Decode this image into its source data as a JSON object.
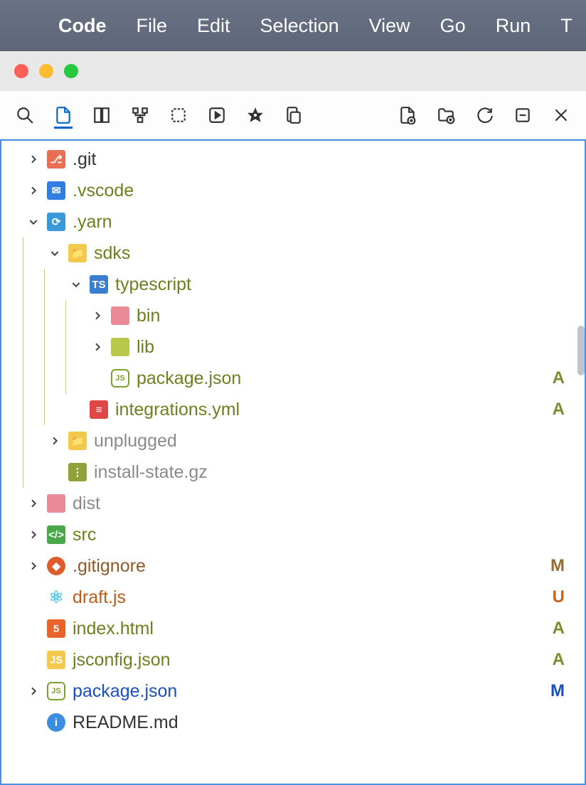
{
  "menubar": {
    "app": "Code",
    "items": [
      "File",
      "Edit",
      "Selection",
      "View",
      "Go",
      "Run",
      "T"
    ]
  },
  "tree": [
    {
      "depth": 0,
      "chev": "right",
      "icon": "git",
      "label": ".git",
      "color": "default",
      "status": ""
    },
    {
      "depth": 0,
      "chev": "right",
      "icon": "vscode",
      "label": ".vscode",
      "color": "olive",
      "status": "dot"
    },
    {
      "depth": 0,
      "chev": "down",
      "icon": "yarn",
      "label": ".yarn",
      "color": "olive",
      "status": "dot"
    },
    {
      "depth": 1,
      "chev": "down",
      "icon": "folder-y",
      "label": "sdks",
      "color": "olive",
      "status": "dot"
    },
    {
      "depth": 2,
      "chev": "down",
      "icon": "ts",
      "label": "typescript",
      "color": "olive",
      "status": "dot"
    },
    {
      "depth": 3,
      "chev": "right",
      "icon": "bin",
      "label": "bin",
      "color": "olive",
      "status": "dot"
    },
    {
      "depth": 3,
      "chev": "right",
      "icon": "lib",
      "label": "lib",
      "color": "olive",
      "status": "dot"
    },
    {
      "depth": 3,
      "chev": "none",
      "icon": "json",
      "label": "package.json",
      "color": "olive",
      "status": "A"
    },
    {
      "depth": 2,
      "chev": "none",
      "icon": "yml",
      "label": "integrations.yml",
      "color": "olive",
      "status": "A"
    },
    {
      "depth": 1,
      "chev": "right",
      "icon": "folder-y",
      "label": "unplugged",
      "color": "grey",
      "status": ""
    },
    {
      "depth": 1,
      "chev": "none",
      "icon": "gz",
      "label": "install-state.gz",
      "color": "grey",
      "status": ""
    },
    {
      "depth": 0,
      "chev": "right",
      "icon": "dist",
      "label": "dist",
      "color": "grey",
      "status": ""
    },
    {
      "depth": 0,
      "chev": "right",
      "icon": "src",
      "label": "src",
      "color": "olive",
      "status": "dot"
    },
    {
      "depth": 0,
      "chev": "right",
      "icon": "gitignore",
      "label": ".gitignore",
      "color": "brown",
      "status": "M",
      "stcolor": "brown"
    },
    {
      "depth": 0,
      "chev": "none",
      "icon": "react",
      "label": "draft.js",
      "color": "orange",
      "status": "U",
      "stcolor": "orange"
    },
    {
      "depth": 0,
      "chev": "none",
      "icon": "html",
      "label": "index.html",
      "color": "olive",
      "status": "A"
    },
    {
      "depth": 0,
      "chev": "none",
      "icon": "jsconfig",
      "label": "jsconfig.json",
      "color": "olive",
      "status": "A"
    },
    {
      "depth": 0,
      "chev": "right",
      "icon": "json",
      "label": "package.json",
      "color": "blue",
      "status": "M",
      "stcolor": "blue"
    },
    {
      "depth": 0,
      "chev": "none",
      "icon": "readme",
      "label": "README.md",
      "color": "default",
      "status": ""
    }
  ]
}
